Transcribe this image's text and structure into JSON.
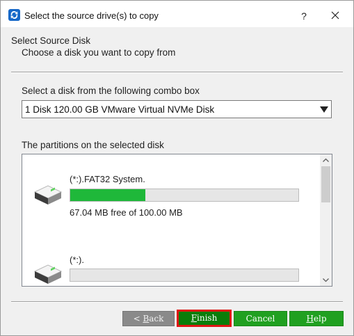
{
  "window": {
    "title": "Select the source drive(s) to copy",
    "help_button": "?"
  },
  "header": {
    "title": "Select Source Disk",
    "subtitle": "Choose a disk you want to copy from"
  },
  "disk_select": {
    "label": "Select a disk from the following combo box",
    "selected": "1 Disk 120.00 GB VMware Virtual NVMe Disk"
  },
  "partitions": {
    "label": "The partitions on the selected disk",
    "items": [
      {
        "name": "(*:).FAT32 System.",
        "used_fraction": 0.33,
        "free_text": "67.04 MB free of 100.00 MB"
      },
      {
        "name": "(*:).",
        "used_fraction": 0.0,
        "free_text": ""
      }
    ]
  },
  "buttons": {
    "back_prefix": "< ",
    "back_mnemonic": "B",
    "back_rest": "ack",
    "finish_mnemonic": "F",
    "finish_rest": "inish",
    "cancel": "Cancel",
    "help_mnemonic": "H",
    "help_rest": "elp"
  },
  "colors": {
    "progress_fill": "#1fb83a",
    "button_green": "#20a020",
    "button_finish": "#0a7d0a",
    "highlight_border": "#e01515",
    "button_disabled": "#8a8a8a"
  }
}
